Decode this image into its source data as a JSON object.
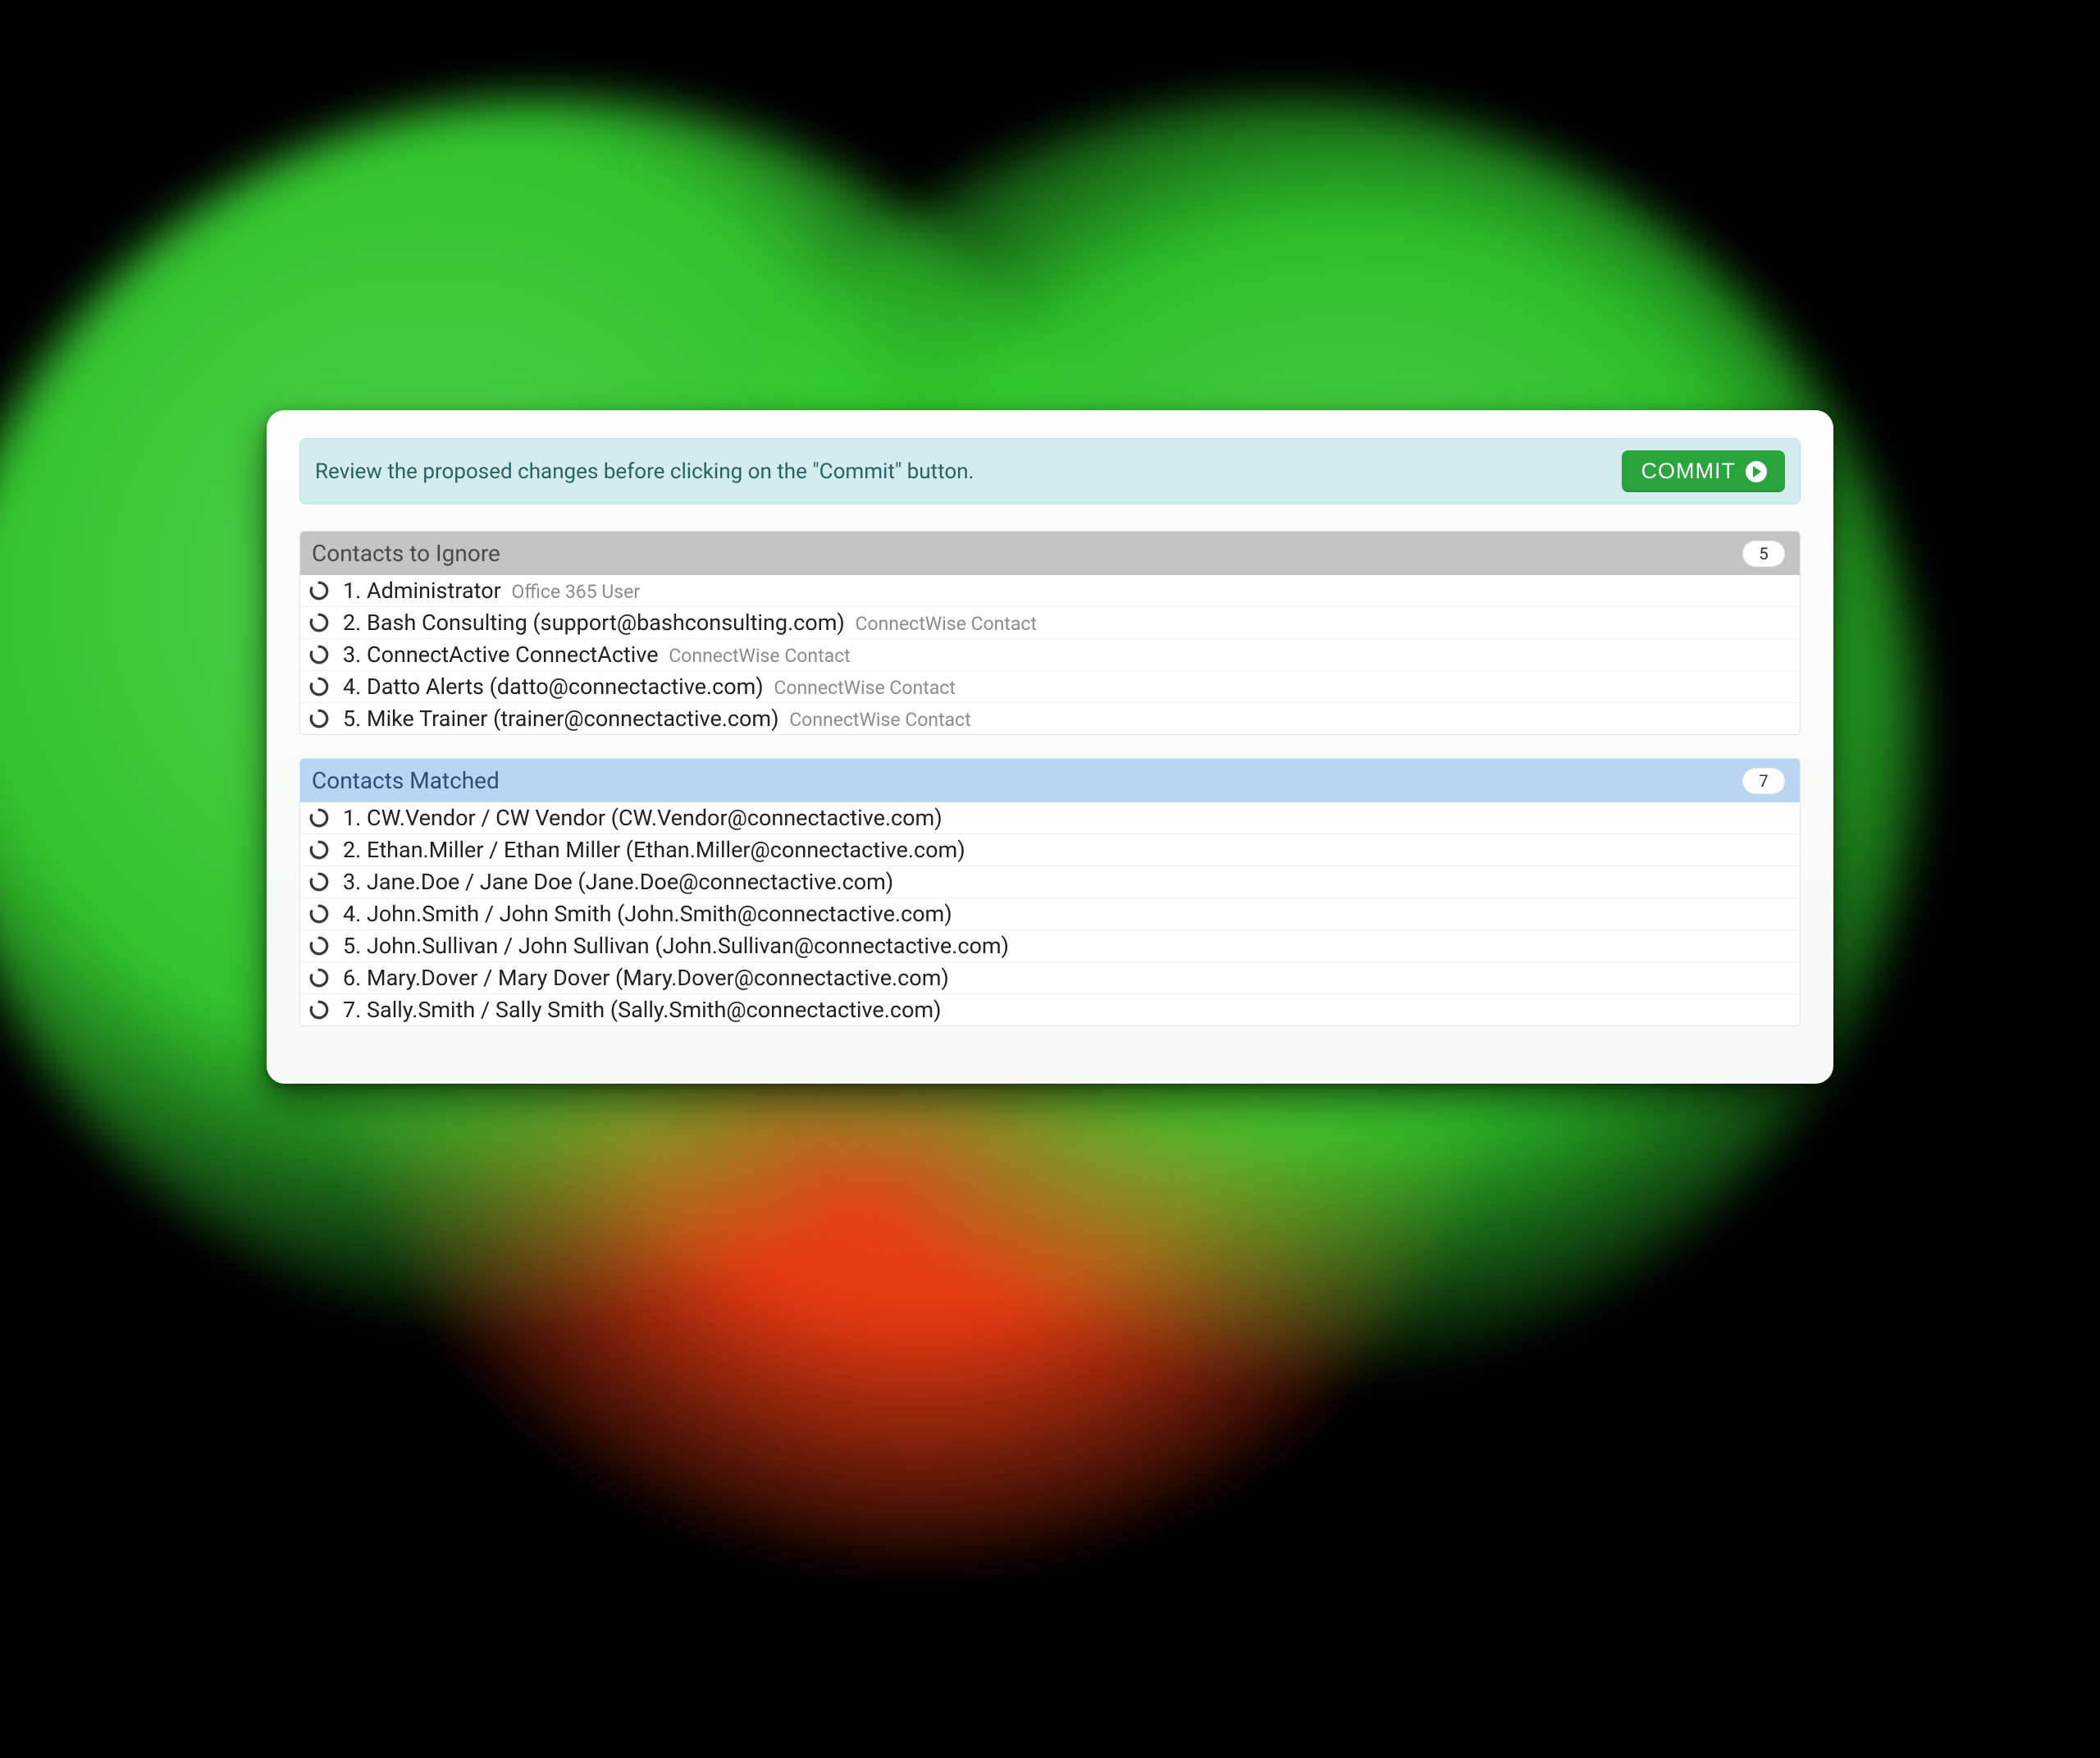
{
  "info": {
    "text": "Review the proposed changes before clicking on the \"Commit\" button.",
    "commit_label": "COMMIT"
  },
  "sections": {
    "ignore": {
      "title": "Contacts to Ignore",
      "count": "5",
      "items": [
        {
          "num": "1.",
          "title": "Administrator",
          "meta": "Office 365 User"
        },
        {
          "num": "2.",
          "title": "Bash Consulting (support@bashconsulting.com)",
          "meta": "ConnectWise Contact"
        },
        {
          "num": "3.",
          "title": "ConnectActive ConnectActive",
          "meta": "ConnectWise Contact"
        },
        {
          "num": "4.",
          "title": "Datto Alerts (datto@connectactive.com)",
          "meta": "ConnectWise Contact"
        },
        {
          "num": "5.",
          "title": "Mike Trainer (trainer@connectactive.com)",
          "meta": "ConnectWise Contact"
        }
      ]
    },
    "matched": {
      "title": "Contacts Matched",
      "count": "7",
      "items": [
        {
          "num": "1.",
          "title": "CW.Vendor / CW Vendor (CW.Vendor@connectactive.com)",
          "meta": ""
        },
        {
          "num": "2.",
          "title": "Ethan.Miller / Ethan Miller (Ethan.Miller@connectactive.com)",
          "meta": ""
        },
        {
          "num": "3.",
          "title": "Jane.Doe / Jane Doe (Jane.Doe@connectactive.com)",
          "meta": ""
        },
        {
          "num": "4.",
          "title": "John.Smith / John Smith (John.Smith@connectactive.com)",
          "meta": ""
        },
        {
          "num": "5.",
          "title": "John.Sullivan / John Sullivan (John.Sullivan@connectactive.com)",
          "meta": ""
        },
        {
          "num": "6.",
          "title": "Mary.Dover / Mary Dover (Mary.Dover@connectactive.com)",
          "meta": ""
        },
        {
          "num": "7.",
          "title": "Sally.Smith / Sally Smith (Sally.Smith@connectactive.com)",
          "meta": ""
        }
      ]
    }
  }
}
